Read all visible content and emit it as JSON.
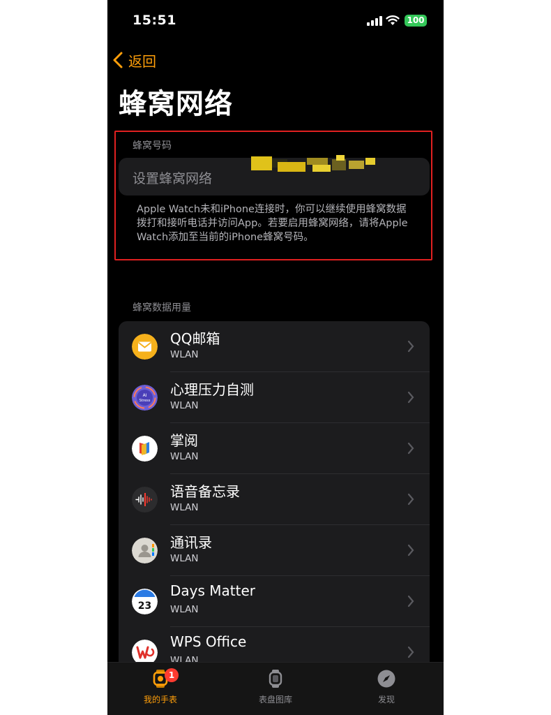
{
  "status_bar": {
    "time": "15:51",
    "battery": "100"
  },
  "nav": {
    "back_label": "返回",
    "title": "蜂窝网络"
  },
  "cellular": {
    "section_label": "蜂窝号码",
    "setup_label": "设置蜂窝网络",
    "footer": "Apple Watch未和iPhone连接时，你可以继续使用蜂窝数据拨打和接听电话并访问App。若要启用蜂窝网络，请将Apple Watch添加至当前的iPhone蜂窝号码。"
  },
  "data_usage": {
    "section_label": "蜂窝数据用量",
    "apps": [
      {
        "name": "QQ邮箱",
        "sub": "WLAN",
        "icon": "qq-mail-icon"
      },
      {
        "name": "心理压力自测",
        "sub": "WLAN",
        "icon": "ai-stress-icon",
        "icon_text": [
          "AI",
          "Stress"
        ]
      },
      {
        "name": "掌阅",
        "sub": "WLAN",
        "icon": "zhangyue-icon"
      },
      {
        "name": "语音备忘录",
        "sub": "WLAN",
        "icon": "voice-memos-icon"
      },
      {
        "name": "通讯录",
        "sub": "WLAN",
        "icon": "contacts-icon"
      },
      {
        "name": "Days Matter",
        "sub": "WLAN",
        "icon": "days-matter-icon",
        "icon_text": "23"
      },
      {
        "name": "WPS Office",
        "sub": "WLAN",
        "icon": "wps-office-icon"
      }
    ]
  },
  "tab_bar": {
    "tabs": [
      {
        "label": "我的手表",
        "icon": "watch-icon",
        "active": true,
        "badge": "1"
      },
      {
        "label": "表盘图库",
        "icon": "watch-face-gallery-icon",
        "active": false
      },
      {
        "label": "发现",
        "icon": "compass-icon",
        "active": false
      }
    ]
  },
  "colors": {
    "accent": "#ff9f0a",
    "highlight_border": "#e02020",
    "badge": "#ff3b30",
    "battery": "#34c759"
  }
}
